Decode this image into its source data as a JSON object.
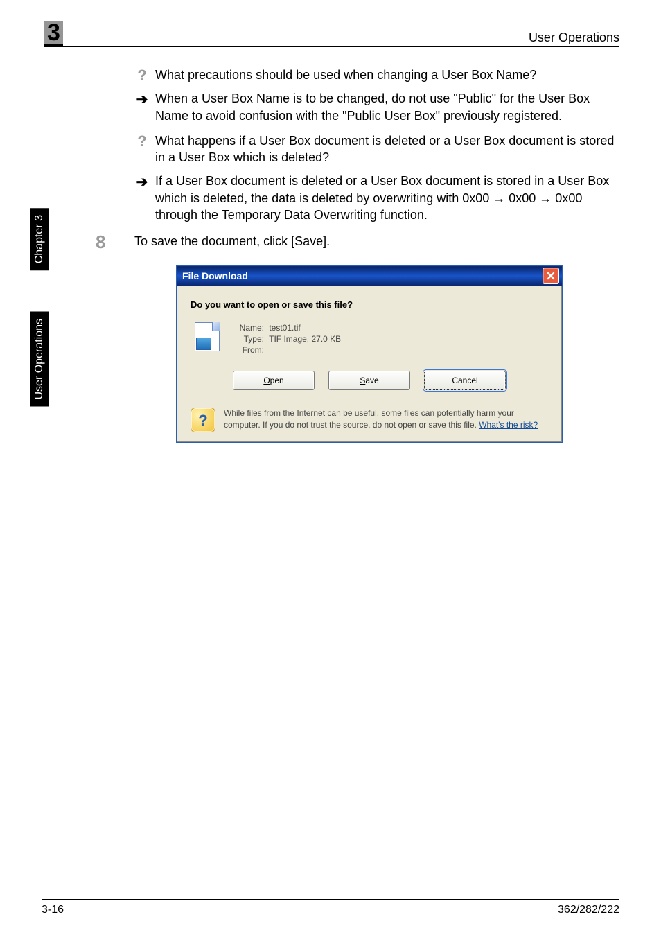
{
  "header": {
    "chapter_number": "3",
    "title": "User Operations"
  },
  "side_tabs": {
    "tab1": "Chapter 3",
    "tab2": "User Operations"
  },
  "qa": {
    "q1": "What precautions should be used when changing a User Box Name?",
    "a1": "When a User Box Name is to be changed, do not use \"Public\" for the User Box Name to avoid confusion with the \"Public User Box\" previously registered.",
    "q2": "What happens if a User Box document is deleted or a User Box document is stored in a User Box which is deleted?",
    "a2": "If a User Box document is deleted or a User Box document is stored in a User Box which is deleted, the data is deleted by overwriting with 0x00 → 0x00 → 0x00 through the Temporary Data Overwriting function."
  },
  "step": {
    "num": "8",
    "text": "To save the document, click [Save]."
  },
  "dialog": {
    "title": "File Download",
    "prompt": "Do you want to open or save this file?",
    "name_label": "Name:",
    "name_value": "test01.tif",
    "type_label": "Type:",
    "type_value": "TIF Image, 27.0 KB",
    "from_label": "From:",
    "from_value": "",
    "btn_open_m": "O",
    "btn_open_rest": "pen",
    "btn_save_m": "S",
    "btn_save_rest": "ave",
    "btn_cancel": "Cancel",
    "warn_text": "While files from the Internet can be useful, some files can potentially harm your computer. If you do not trust the source, do not open or save this file. ",
    "warn_link": "What's the risk?"
  },
  "footer": {
    "page": "3-16",
    "model": "362/282/222"
  }
}
